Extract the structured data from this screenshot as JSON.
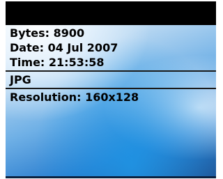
{
  "file_details": {
    "bytes_label": "Bytes:",
    "bytes_value": "8900",
    "date_label": "Date:",
    "date_value": "04 Jul 2007",
    "time_label": "Time:",
    "time_value": "21:53:58",
    "type": "JPG",
    "resolution_label": "Resolution:",
    "resolution_value": "160x128"
  },
  "colors": {
    "header": "#000000",
    "text": "#000000",
    "background_light": "#dcebf7",
    "background_dark": "#1e4f8f"
  }
}
